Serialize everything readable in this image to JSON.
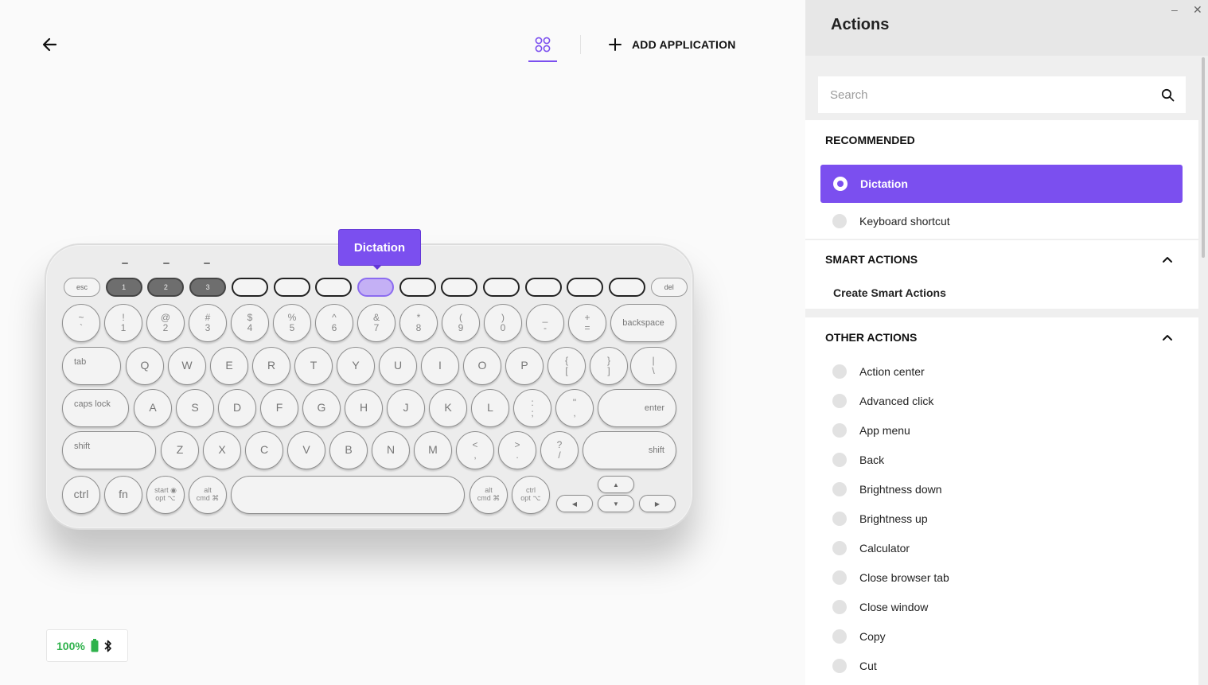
{
  "header": {
    "add_application": "ADD APPLICATION"
  },
  "keyboard": {
    "tooltip": "Dictation",
    "selected_key": "dictation",
    "fn_row": [
      "esc",
      "1",
      "2",
      "3",
      "",
      "",
      "",
      "",
      "",
      "",
      "",
      "",
      "",
      "",
      "del"
    ],
    "num_row": [
      {
        "t": "~",
        "b": "`"
      },
      {
        "t": "!",
        "b": "1"
      },
      {
        "t": "@",
        "b": "2"
      },
      {
        "t": "#",
        "b": "3"
      },
      {
        "t": "$",
        "b": "4"
      },
      {
        "t": "%",
        "b": "5"
      },
      {
        "t": "^",
        "b": "6"
      },
      {
        "t": "&",
        "b": "7"
      },
      {
        "t": "*",
        "b": "8"
      },
      {
        "t": "(",
        "b": "9"
      },
      {
        "t": ")",
        "b": "0"
      },
      {
        "t": "_",
        "b": "-"
      },
      {
        "t": "+",
        "b": "="
      }
    ],
    "backspace": "backspace",
    "tab": "tab",
    "q_row": [
      "Q",
      "W",
      "E",
      "R",
      "T",
      "Y",
      "U",
      "I",
      "O",
      "P"
    ],
    "q_row_extra": [
      {
        "t": "{",
        "b": "["
      },
      {
        "t": "}",
        "b": "]"
      },
      {
        "t": "|",
        "b": "\\"
      }
    ],
    "caps": "caps lock",
    "a_row": [
      "A",
      "S",
      "D",
      "F",
      "G",
      "H",
      "J",
      "K",
      "L"
    ],
    "a_row_extra": [
      {
        "t": ":",
        "b": ";"
      },
      {
        "t": "\"",
        "b": ","
      }
    ],
    "enter": "enter",
    "shift": "shift",
    "z_row": [
      "Z",
      "X",
      "C",
      "V",
      "B",
      "N",
      "M"
    ],
    "z_row_extra": [
      {
        "t": "<",
        "b": ","
      },
      {
        "t": ">",
        "b": "."
      },
      {
        "t": "?",
        "b": "/"
      }
    ],
    "bottom": {
      "ctrl": "ctrl",
      "fn": "fn",
      "start_top": "start ◉",
      "start_bot": "opt ⌥",
      "alt_top": "alt",
      "alt_bot": "cmd ⌘",
      "alt2_top": "alt",
      "alt2_bot": "cmd ⌘",
      "ctrl2_top": "ctrl",
      "ctrl2_bot": "opt ⌥"
    },
    "arrows": {
      "up": "▲",
      "down": "▼",
      "left": "◀",
      "right": "▶"
    }
  },
  "status": {
    "battery": "100%"
  },
  "panel": {
    "title": "Actions",
    "search_placeholder": "Search",
    "recommended_title": "RECOMMENDED",
    "recommended": [
      {
        "label": "Dictation",
        "selected": true
      },
      {
        "label": "Keyboard shortcut",
        "selected": false
      }
    ],
    "smart_title": "SMART ACTIONS",
    "smart_link": "Create Smart Actions",
    "other_title": "OTHER ACTIONS",
    "other": [
      "Action center",
      "Advanced click",
      "App menu",
      "Back",
      "Brightness down",
      "Brightness up",
      "Calculator",
      "Close browser tab",
      "Close window",
      "Copy",
      "Cut"
    ]
  },
  "colors": {
    "accent": "#7b4fef",
    "battery": "#2fb24c"
  }
}
